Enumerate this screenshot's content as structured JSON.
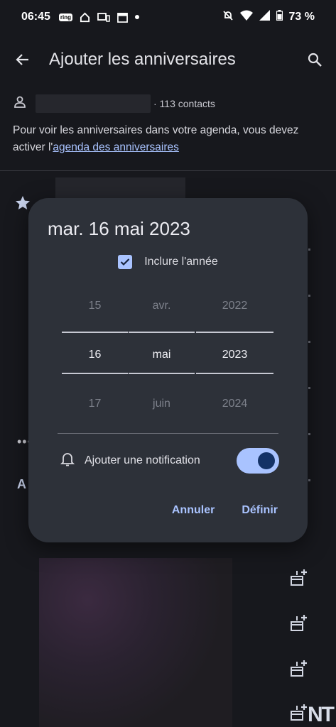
{
  "status_bar": {
    "time": "06:45",
    "ring_label": "ring",
    "battery": "73 %"
  },
  "app_bar": {
    "title": "Ajouter les anniversaires"
  },
  "account": {
    "contacts_count": "· 113 contacts"
  },
  "info": {
    "text": "Pour voir les anniversaires dans votre agenda, vous devez activer l'",
    "link": "agenda des anniversaires"
  },
  "background": {
    "more": "•••",
    "section_letter": "A"
  },
  "dialog": {
    "date": "mar. 16 mai 2023",
    "include_year": {
      "label": "Inclure l'année",
      "checked": true
    },
    "picker": {
      "days": [
        "15",
        "16",
        "17"
      ],
      "months": [
        "avr.",
        "mai",
        "juin"
      ],
      "years": [
        "2022",
        "2023",
        "2024"
      ]
    },
    "notification": {
      "label": "Ajouter une notification",
      "enabled": true
    },
    "cancel_label": "Annuler",
    "confirm_label": "Définir"
  },
  "watermark": "NT",
  "colors": {
    "background": "#17181d",
    "dialog": "#2d3139",
    "accent": "#a9c3ff"
  }
}
